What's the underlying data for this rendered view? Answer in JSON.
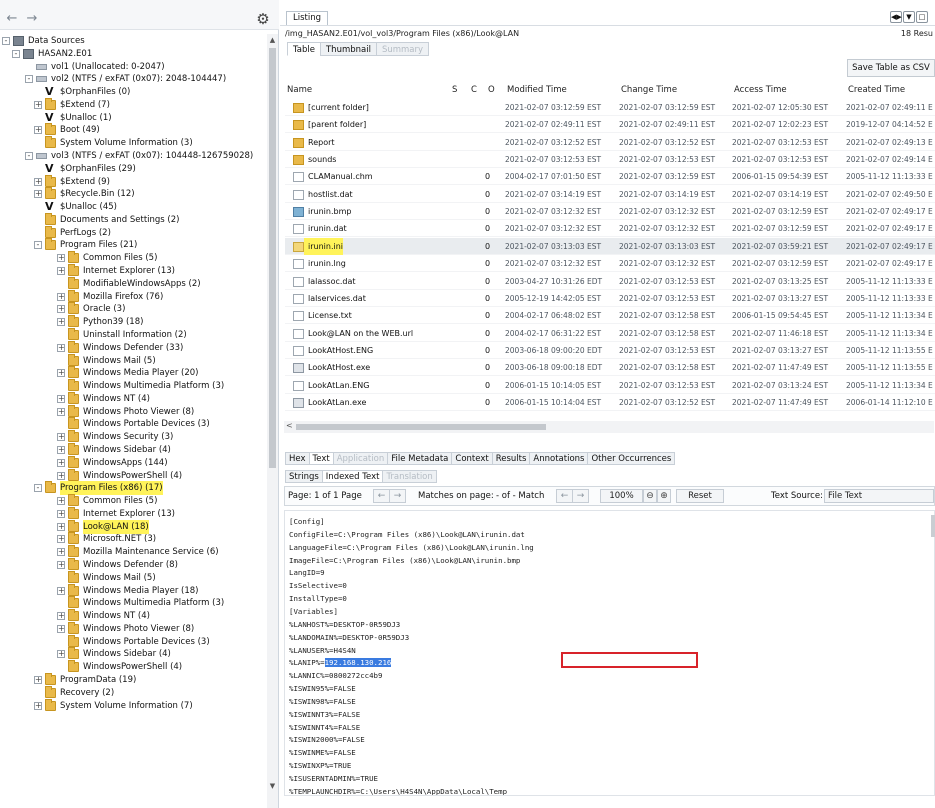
{
  "left": {
    "back_icon": "back-arrow-icon",
    "forward_icon": "forward-arrow-icon",
    "settings_icon": "gear-icon",
    "tree": [
      {
        "label": "Data Sources",
        "depth": 0,
        "icon": "disk",
        "expander": "-"
      },
      {
        "label": "HASAN2.E01",
        "depth": 1,
        "icon": "disk",
        "expander": "-"
      },
      {
        "label": "vol1 (Unallocated: 0-2047)",
        "depth": 2,
        "icon": "vol",
        "expander": ""
      },
      {
        "label": "vol2 (NTFS / exFAT (0x07): 2048-104447)",
        "depth": 2,
        "icon": "vol",
        "expander": "-"
      },
      {
        "label": "$OrphanFiles (0)",
        "depth": 3,
        "icon": "orphan",
        "expander": ""
      },
      {
        "label": "$Extend (7)",
        "depth": 3,
        "icon": "folder",
        "expander": "+"
      },
      {
        "label": "$Unalloc (1)",
        "depth": 3,
        "icon": "orphan",
        "expander": ""
      },
      {
        "label": "Boot (49)",
        "depth": 3,
        "icon": "folder",
        "expander": "+"
      },
      {
        "label": "System Volume Information (3)",
        "depth": 3,
        "icon": "folder",
        "expander": ""
      },
      {
        "label": "vol3 (NTFS / exFAT (0x07): 104448-126759028)",
        "depth": 2,
        "icon": "vol",
        "expander": "-"
      },
      {
        "label": "$OrphanFiles (29)",
        "depth": 3,
        "icon": "orphan",
        "expander": ""
      },
      {
        "label": "$Extend (9)",
        "depth": 3,
        "icon": "folder",
        "expander": "+"
      },
      {
        "label": "$Recycle.Bin (12)",
        "depth": 3,
        "icon": "folder",
        "expander": "+"
      },
      {
        "label": "$Unalloc (45)",
        "depth": 3,
        "icon": "orphan",
        "expander": ""
      },
      {
        "label": "Documents and Settings (2)",
        "depth": 3,
        "icon": "folder",
        "expander": ""
      },
      {
        "label": "PerfLogs (2)",
        "depth": 3,
        "icon": "folder",
        "expander": ""
      },
      {
        "label": "Program Files (21)",
        "depth": 3,
        "icon": "folder",
        "expander": "-"
      },
      {
        "label": "Common Files (5)",
        "depth": 4,
        "icon": "folder",
        "expander": "+"
      },
      {
        "label": "Internet Explorer (13)",
        "depth": 4,
        "icon": "folder",
        "expander": "+"
      },
      {
        "label": "ModifiableWindowsApps (2)",
        "depth": 4,
        "icon": "folder",
        "expander": ""
      },
      {
        "label": "Mozilla Firefox (76)",
        "depth": 4,
        "icon": "folder",
        "expander": "+"
      },
      {
        "label": "Oracle (3)",
        "depth": 4,
        "icon": "folder",
        "expander": "+"
      },
      {
        "label": "Python39 (18)",
        "depth": 4,
        "icon": "folder",
        "expander": "+"
      },
      {
        "label": "Uninstall Information (2)",
        "depth": 4,
        "icon": "folder",
        "expander": ""
      },
      {
        "label": "Windows Defender (33)",
        "depth": 4,
        "icon": "folder",
        "expander": "+"
      },
      {
        "label": "Windows Mail (5)",
        "depth": 4,
        "icon": "folder",
        "expander": ""
      },
      {
        "label": "Windows Media Player (20)",
        "depth": 4,
        "icon": "folder",
        "expander": "+"
      },
      {
        "label": "Windows Multimedia Platform (3)",
        "depth": 4,
        "icon": "folder",
        "expander": ""
      },
      {
        "label": "Windows NT (4)",
        "depth": 4,
        "icon": "folder",
        "expander": "+"
      },
      {
        "label": "Windows Photo Viewer (8)",
        "depth": 4,
        "icon": "folder",
        "expander": "+"
      },
      {
        "label": "Windows Portable Devices (3)",
        "depth": 4,
        "icon": "folder",
        "expander": ""
      },
      {
        "label": "Windows Security (3)",
        "depth": 4,
        "icon": "folder",
        "expander": "+"
      },
      {
        "label": "Windows Sidebar (4)",
        "depth": 4,
        "icon": "folder",
        "expander": "+"
      },
      {
        "label": "WindowsApps (144)",
        "depth": 4,
        "icon": "folder",
        "expander": "+"
      },
      {
        "label": "WindowsPowerShell (4)",
        "depth": 4,
        "icon": "folder",
        "expander": "+"
      },
      {
        "label": "Program Files (x86) (17)",
        "depth": 3,
        "icon": "folder",
        "expander": "-",
        "highlight": true
      },
      {
        "label": "Common Files (5)",
        "depth": 4,
        "icon": "folder",
        "expander": "+"
      },
      {
        "label": "Internet Explorer (13)",
        "depth": 4,
        "icon": "folder",
        "expander": "+"
      },
      {
        "label": "Look@LAN (18)",
        "depth": 4,
        "icon": "folder",
        "expander": "+",
        "highlight": true
      },
      {
        "label": "Microsoft.NET (3)",
        "depth": 4,
        "icon": "folder",
        "expander": "+"
      },
      {
        "label": "Mozilla Maintenance Service (6)",
        "depth": 4,
        "icon": "folder",
        "expander": "+"
      },
      {
        "label": "Windows Defender (8)",
        "depth": 4,
        "icon": "folder",
        "expander": "+"
      },
      {
        "label": "Windows Mail (5)",
        "depth": 4,
        "icon": "folder",
        "expander": ""
      },
      {
        "label": "Windows Media Player (18)",
        "depth": 4,
        "icon": "folder",
        "expander": "+"
      },
      {
        "label": "Windows Multimedia Platform (3)",
        "depth": 4,
        "icon": "folder",
        "expander": ""
      },
      {
        "label": "Windows NT (4)",
        "depth": 4,
        "icon": "folder",
        "expander": "+"
      },
      {
        "label": "Windows Photo Viewer (8)",
        "depth": 4,
        "icon": "folder",
        "expander": "+"
      },
      {
        "label": "Windows Portable Devices (3)",
        "depth": 4,
        "icon": "folder",
        "expander": ""
      },
      {
        "label": "Windows Sidebar (4)",
        "depth": 4,
        "icon": "folder",
        "expander": "+"
      },
      {
        "label": "WindowsPowerShell (4)",
        "depth": 4,
        "icon": "folder",
        "expander": ""
      },
      {
        "label": "ProgramData (19)",
        "depth": 3,
        "icon": "folder",
        "expander": "+"
      },
      {
        "label": "Recovery (2)",
        "depth": 3,
        "icon": "folder",
        "expander": ""
      },
      {
        "label": "System Volume Information (7)",
        "depth": 3,
        "icon": "folder",
        "expander": "+"
      }
    ]
  },
  "listing": {
    "tab": "Listing",
    "path": "/img_HASAN2.E01/vol_vol3/Program Files (x86)/Look@LAN",
    "result_count": "18 Resu",
    "subtabs": [
      {
        "label": "Table",
        "state": "active"
      },
      {
        "label": "Thumbnail",
        "state": "normal"
      },
      {
        "label": "Summary",
        "state": "disabled"
      }
    ],
    "save_button": "Save Table as CSV",
    "columns": {
      "name": "Name",
      "s": "S",
      "c": "C",
      "o": "O",
      "modified": "Modified Time",
      "change": "Change Time",
      "access": "Access Time",
      "created": "Created Time"
    },
    "rows": [
      {
        "icon": "folder",
        "name": "[current folder]",
        "o": "",
        "modified": "2021-02-07 03:12:59 EST",
        "change": "2021-02-07 03:12:59 EST",
        "access": "2021-02-07 12:05:30 EST",
        "created": "2021-02-07 02:49:11 E"
      },
      {
        "icon": "folder",
        "name": "[parent folder]",
        "o": "",
        "modified": "2021-02-07 02:49:11 EST",
        "change": "2021-02-07 02:49:11 EST",
        "access": "2021-02-07 12:02:23 EST",
        "created": "2019-12-07 04:14:52 E"
      },
      {
        "icon": "folder",
        "name": "Report",
        "o": "",
        "modified": "2021-02-07 03:12:52 EST",
        "change": "2021-02-07 03:12:52 EST",
        "access": "2021-02-07 03:12:53 EST",
        "created": "2021-02-07 02:49:13 E"
      },
      {
        "icon": "folder",
        "name": "sounds",
        "o": "",
        "modified": "2021-02-07 03:12:53 EST",
        "change": "2021-02-07 03:12:53 EST",
        "access": "2021-02-07 03:12:53 EST",
        "created": "2021-02-07 02:49:14 E"
      },
      {
        "icon": "file",
        "name": "CLAManual.chm",
        "o": "0",
        "modified": "2004-02-17 07:01:50 EST",
        "change": "2021-02-07 03:12:59 EST",
        "access": "2006-01-15 09:54:39 EST",
        "created": "2005-11-12 11:13:33 E"
      },
      {
        "icon": "file",
        "name": "hostlist.dat",
        "o": "0",
        "modified": "2021-02-07 03:14:19 EST",
        "change": "2021-02-07 03:14:19 EST",
        "access": "2021-02-07 03:14:19 EST",
        "created": "2021-02-07 02:49:50 E"
      },
      {
        "icon": "img",
        "name": "irunin.bmp",
        "o": "0",
        "modified": "2021-02-07 03:12:32 EST",
        "change": "2021-02-07 03:12:32 EST",
        "access": "2021-02-07 03:12:59 EST",
        "created": "2021-02-07 02:49:17 E"
      },
      {
        "icon": "file",
        "name": "irunin.dat",
        "o": "0",
        "modified": "2021-02-07 03:12:32 EST",
        "change": "2021-02-07 03:12:32 EST",
        "access": "2021-02-07 03:12:59 EST",
        "created": "2021-02-07 02:49:17 E"
      },
      {
        "icon": "ini",
        "name": "irunin.ini",
        "o": "0",
        "modified": "2021-02-07 03:13:03 EST",
        "change": "2021-02-07 03:13:03 EST",
        "access": "2021-02-07 03:59:21 EST",
        "created": "2021-02-07 02:49:17 E",
        "selected": true,
        "highlight": true
      },
      {
        "icon": "file",
        "name": "irunin.lng",
        "o": "0",
        "modified": "2021-02-07 03:12:32 EST",
        "change": "2021-02-07 03:12:32 EST",
        "access": "2021-02-07 03:12:59 EST",
        "created": "2021-02-07 02:49:17 E"
      },
      {
        "icon": "file",
        "name": "lalassoc.dat",
        "o": "0",
        "modified": "2003-04-27 10:31:26 EDT",
        "change": "2021-02-07 03:12:53 EST",
        "access": "2021-02-07 03:13:25 EST",
        "created": "2005-11-12 11:13:33 E"
      },
      {
        "icon": "file",
        "name": "lalservices.dat",
        "o": "0",
        "modified": "2005-12-19 14:42:05 EST",
        "change": "2021-02-07 03:12:53 EST",
        "access": "2021-02-07 03:13:27 EST",
        "created": "2005-11-12 11:13:33 E"
      },
      {
        "icon": "file",
        "name": "License.txt",
        "o": "0",
        "modified": "2004-02-17 06:48:02 EST",
        "change": "2021-02-07 03:12:58 EST",
        "access": "2006-01-15 09:54:45 EST",
        "created": "2005-11-12 11:13:34 E"
      },
      {
        "icon": "file",
        "name": "Look@LAN on the WEB.url",
        "o": "0",
        "modified": "2004-02-17 06:31:22 EST",
        "change": "2021-02-07 03:12:58 EST",
        "access": "2021-02-07 11:46:18 EST",
        "created": "2005-11-12 11:13:34 E"
      },
      {
        "icon": "file",
        "name": "LookAtHost.ENG",
        "o": "0",
        "modified": "2003-06-18 09:00:20 EDT",
        "change": "2021-02-07 03:12:53 EST",
        "access": "2021-02-07 03:13:27 EST",
        "created": "2005-11-12 11:13:55 E"
      },
      {
        "icon": "exe",
        "name": "LookAtHost.exe",
        "o": "0",
        "modified": "2003-06-18 09:00:18 EDT",
        "change": "2021-02-07 03:12:58 EST",
        "access": "2021-02-07 11:47:49 EST",
        "created": "2005-11-12 11:13:55 E"
      },
      {
        "icon": "file",
        "name": "LookAtLan.ENG",
        "o": "0",
        "modified": "2006-01-15 10:14:05 EST",
        "change": "2021-02-07 03:12:53 EST",
        "access": "2021-02-07 03:13:24 EST",
        "created": "2005-11-12 11:13:34 E"
      },
      {
        "icon": "exe",
        "name": "LookAtLan.exe",
        "o": "0",
        "modified": "2006-01-15 10:14:04 EST",
        "change": "2021-02-07 03:12:52 EST",
        "access": "2021-02-07 11:47:49 EST",
        "created": "2006-01-14 11:12:10 E"
      }
    ]
  },
  "content": {
    "tabs": [
      {
        "label": "Hex",
        "state": "normal"
      },
      {
        "label": "Text",
        "state": "active"
      },
      {
        "label": "Application",
        "state": "disabled"
      },
      {
        "label": "File Metadata",
        "state": "normal"
      },
      {
        "label": "Context",
        "state": "normal"
      },
      {
        "label": "Results",
        "state": "normal"
      },
      {
        "label": "Annotations",
        "state": "normal"
      },
      {
        "label": "Other Occurrences",
        "state": "normal"
      }
    ],
    "text_tabs": [
      {
        "label": "Strings",
        "state": "normal"
      },
      {
        "label": "Indexed Text",
        "state": "active"
      },
      {
        "label": "Translation",
        "state": "disabled"
      }
    ],
    "find": {
      "page_label": "Page: 1 of 1 Page",
      "matches_label": "Matches on page:",
      "matches_value": "- of - Match",
      "zoom": "100%",
      "reset": "Reset",
      "text_source_label": "Text Source:",
      "text_source_value": "File Text"
    },
    "lines": [
      "[Config]",
      "ConfigFile=C:\\Program Files (x86)\\Look@LAN\\irunin.dat",
      "LanguageFile=C:\\Program Files (x86)\\Look@LAN\\irunin.lng",
      "ImageFile=C:\\Program Files (x86)\\Look@LAN\\irunin.bmp",
      "LangID=9",
      "IsSelective=0",
      "InstallType=0",
      "[Variables]",
      "%LANHOST%=DESKTOP-0R59DJ3",
      "%LANDOMAIN%=DESKTOP-0R59DJ3",
      "%LANUSER%=H4S4N",
      "%LANIP%=",
      "%LANNIC%=0800272cc4b9",
      "%ISWIN95%=FALSE",
      "%ISWIN98%=FALSE",
      "%ISWINNT3%=FALSE",
      "%ISWINNT4%=FALSE",
      "%ISWIN2000%=FALSE",
      "%ISWINME%=FALSE",
      "%ISWINXP%=TRUE",
      "%ISUSERNTADMIN%=TRUE",
      "%TEMPLAUNCHDIR%=C:\\Users\\H4S4N\\AppData\\Local\\Temp"
    ],
    "ip_value": "192.168.130.216"
  },
  "colors": {
    "highlight": "#fff35a",
    "selection": "#3a7be0",
    "callout": "#d8232a"
  }
}
